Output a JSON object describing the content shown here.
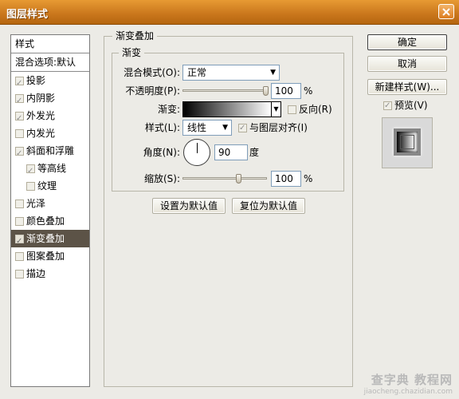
{
  "window": {
    "title": "图层样式"
  },
  "sidebar": {
    "header": "样式",
    "blend_options": "混合选项:默认",
    "items": [
      {
        "label": "投影",
        "checked": true,
        "sub": false,
        "selected": false
      },
      {
        "label": "内阴影",
        "checked": true,
        "sub": false,
        "selected": false
      },
      {
        "label": "外发光",
        "checked": true,
        "sub": false,
        "selected": false
      },
      {
        "label": "内发光",
        "checked": false,
        "sub": false,
        "selected": false
      },
      {
        "label": "斜面和浮雕",
        "checked": true,
        "sub": false,
        "selected": false
      },
      {
        "label": "等高线",
        "checked": true,
        "sub": true,
        "selected": false
      },
      {
        "label": "纹理",
        "checked": false,
        "sub": true,
        "selected": false
      },
      {
        "label": "光泽",
        "checked": false,
        "sub": false,
        "selected": false
      },
      {
        "label": "颜色叠加",
        "checked": false,
        "sub": false,
        "selected": false
      },
      {
        "label": "渐变叠加",
        "checked": true,
        "sub": false,
        "selected": true
      },
      {
        "label": "图案叠加",
        "checked": false,
        "sub": false,
        "selected": false
      },
      {
        "label": "描边",
        "checked": false,
        "sub": false,
        "selected": false
      }
    ]
  },
  "panel": {
    "outer_title": "渐变叠加",
    "inner_title": "渐变",
    "blend_mode_label": "混合模式(O):",
    "blend_mode_value": "正常",
    "opacity_label": "不透明度(P):",
    "opacity_value": "100",
    "opacity_percent": 100,
    "unit_percent": "%",
    "gradient_label": "渐变:",
    "reverse_label": "反向(R)",
    "reverse_checked": false,
    "style_label": "样式(L):",
    "style_value": "线性",
    "align_label": "与图层对齐(I)",
    "align_checked": true,
    "angle_label": "角度(N):",
    "angle_value": "90",
    "angle_unit": "度",
    "scale_label": "缩放(S):",
    "scale_value": "100",
    "scale_percent": 100,
    "set_default_button": "设置为默认值",
    "reset_default_button": "复位为默认值"
  },
  "actions": {
    "ok_button": "确定",
    "cancel_button": "取消",
    "new_style_button": "新建样式(W)...",
    "preview_label": "预览(V)",
    "preview_checked": true
  },
  "watermark": {
    "text": "查字典 教程网",
    "url": "jiaocheng.chazidian.com"
  }
}
